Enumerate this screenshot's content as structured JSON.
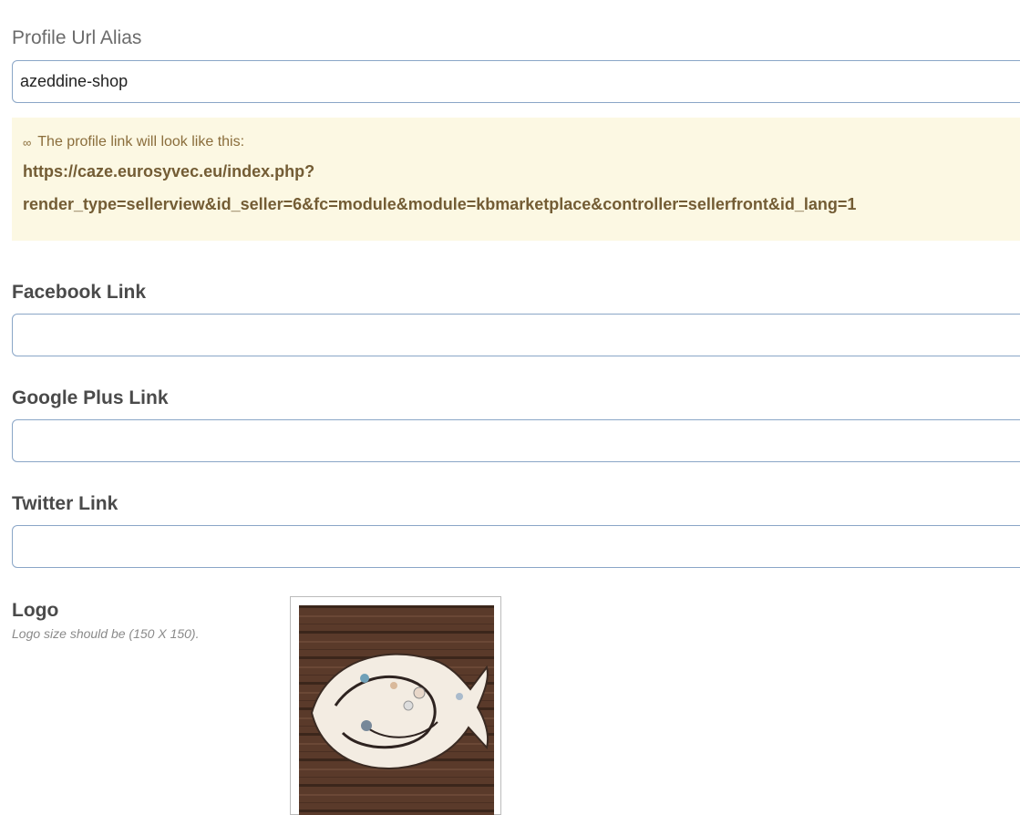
{
  "profile_alias": {
    "label": "Profile Url Alias",
    "value": "azeddine-shop"
  },
  "profile_notice": {
    "text": "The profile link will look like this:",
    "link_line1": "https://caze.eurosyvec.eu/index.php?",
    "link_line2": "render_type=sellerview&id_seller=6&fc=module&module=kbmarketplace&controller=sellerfront&id_lang=1",
    "icon": "link-icon"
  },
  "facebook": {
    "label": "Facebook Link",
    "value": ""
  },
  "googleplus": {
    "label": "Google Plus Link",
    "value": ""
  },
  "twitter": {
    "label": "Twitter Link",
    "value": ""
  },
  "logo": {
    "label": "Logo",
    "hint": "Logo size should be (150 X 150)."
  }
}
